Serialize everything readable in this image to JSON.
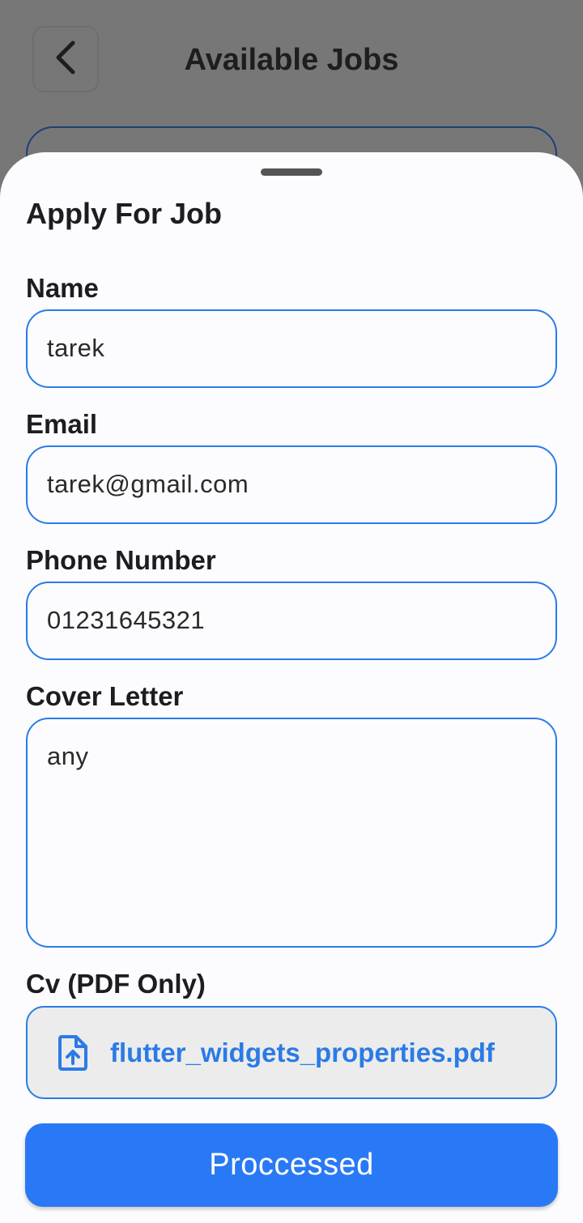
{
  "header": {
    "title": "Available Jobs",
    "back_icon": "chevron-left-icon"
  },
  "sheet": {
    "title": "Apply For Job",
    "fields": {
      "name": {
        "label": "Name",
        "value": "tarek"
      },
      "email": {
        "label": "Email",
        "value": "tarek@gmail.com"
      },
      "phone": {
        "label": "Phone Number",
        "value": "01231645321"
      },
      "cover_letter": {
        "label": "Cover Letter",
        "value": "any"
      },
      "cv": {
        "label": "Cv (PDF Only)",
        "file_name": "flutter_widgets_properties.pdf",
        "icon": "file-upload-icon"
      }
    },
    "submit_label": "Proccessed"
  },
  "colors": {
    "accent": "#2979f6",
    "border": "#2b7be6",
    "overlay": "#777777",
    "sheet_bg": "#fcfcff"
  }
}
